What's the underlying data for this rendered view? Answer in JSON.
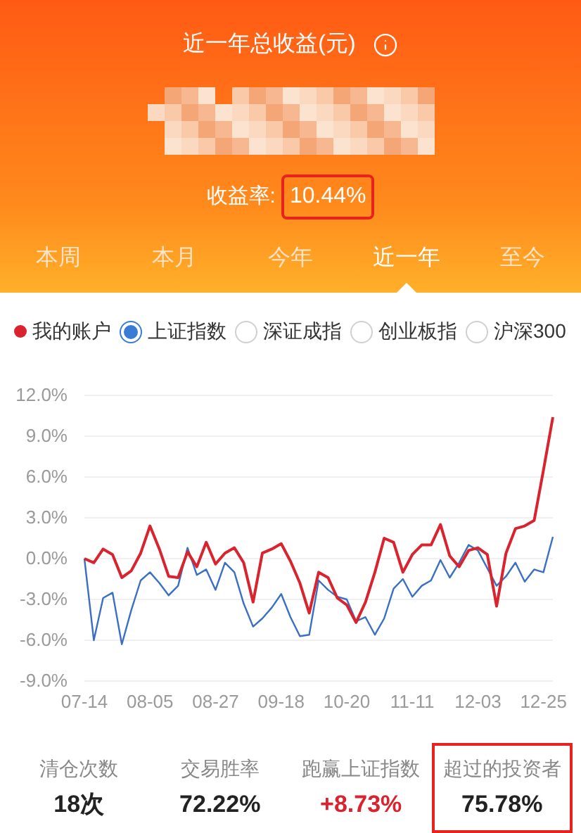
{
  "header": {
    "title": "近一年总收益(元)",
    "rate_label": "收益率:",
    "rate_value": "10.44%",
    "rate_highlighted": true
  },
  "tabs": [
    {
      "label": "本周",
      "selected": false
    },
    {
      "label": "本月",
      "selected": false
    },
    {
      "label": "今年",
      "selected": false
    },
    {
      "label": "近一年",
      "selected": true
    },
    {
      "label": "至今",
      "selected": false
    }
  ],
  "legend": [
    {
      "kind": "dot",
      "label": "我的账户",
      "color": "#d9232e"
    },
    {
      "kind": "radio",
      "label": "上证指数",
      "selected": true
    },
    {
      "kind": "radio",
      "label": "深证成指",
      "selected": false
    },
    {
      "kind": "radio",
      "label": "创业板指",
      "selected": false
    },
    {
      "kind": "radio",
      "label": "沪深300",
      "selected": false
    }
  ],
  "chart": {
    "chart_data": {
      "type": "line",
      "grid": true,
      "ylim": [
        -9,
        12
      ],
      "yticks": [
        {
          "value": 12,
          "label": "12.0%"
        },
        {
          "value": 9,
          "label": "9.0%"
        },
        {
          "value": 6,
          "label": "6.0%"
        },
        {
          "value": 3,
          "label": "3.0%"
        },
        {
          "value": 0,
          "label": "0.0%"
        },
        {
          "value": -3,
          "label": "-3.0%"
        },
        {
          "value": -6,
          "label": "-6.0%"
        },
        {
          "value": -9,
          "label": "-9.0%"
        }
      ],
      "categories": [
        "07-14",
        null,
        null,
        null,
        null,
        null,
        null,
        "08-05",
        null,
        null,
        null,
        null,
        null,
        null,
        "08-27",
        null,
        null,
        null,
        null,
        null,
        null,
        "09-18",
        null,
        null,
        null,
        null,
        null,
        null,
        "10-20",
        null,
        null,
        null,
        null,
        null,
        null,
        "11-11",
        null,
        null,
        null,
        null,
        null,
        null,
        "12-03",
        null,
        null,
        null,
        null,
        null,
        null,
        "12-25",
        null
      ],
      "series": [
        {
          "color": "#d9232e",
          "values": [
            0,
            -0.3,
            0.7,
            0.3,
            -1.4,
            -0.9,
            0.4,
            2.4,
            0.7,
            -1.3,
            -1.4,
            0.5,
            -0.6,
            1.2,
            -0.4,
            0.4,
            0.8,
            -0.3,
            -3.2,
            0.4,
            0.7,
            1.1,
            -0.2,
            -1.8,
            -4.0,
            -1.0,
            -1.4,
            -2.9,
            -3.4,
            -4.7,
            -3.2,
            -1.0,
            1.5,
            1.2,
            -1.0,
            0.3,
            1.0,
            1.0,
            2.5,
            0.2,
            -0.6,
            0.6,
            0.8,
            0.3,
            -3.5,
            0.4,
            2.2,
            2.4,
            2.8,
            6.5,
            10.4
          ]
        },
        {
          "color": "#3a6fc4",
          "values": [
            0,
            -6.0,
            -2.9,
            -2.5,
            -6.3,
            -3.8,
            -1.6,
            -1.0,
            -1.8,
            -2.7,
            -2.0,
            0.8,
            -1.2,
            -0.8,
            -2.3,
            -0.3,
            -1.0,
            -3.3,
            -5.0,
            -4.4,
            -3.6,
            -2.6,
            -4.3,
            -5.7,
            -5.6,
            -1.6,
            -2.3,
            -2.8,
            -3.0,
            -4.6,
            -4.3,
            -5.6,
            -4.4,
            -2.2,
            -1.5,
            -2.8,
            -2.0,
            -1.6,
            -0.1,
            -1.4,
            -0.3,
            1.0,
            0.6,
            -0.7,
            -2.0,
            -1.3,
            -0.3,
            -1.7,
            -0.8,
            -1.0,
            1.6
          ]
        }
      ]
    }
  },
  "stats": [
    {
      "label": "清仓次数",
      "value": "18次",
      "color": "#222222",
      "highlighted": false
    },
    {
      "label": "交易胜率",
      "value": "72.22%",
      "color": "#222222",
      "highlighted": false
    },
    {
      "label": "跑赢上证指数",
      "value": "+8.73%",
      "color": "#d9232e",
      "highlighted": false
    },
    {
      "label": "超过的投资者",
      "value": "75.78%",
      "color": "#222222",
      "highlighted": true
    }
  ]
}
